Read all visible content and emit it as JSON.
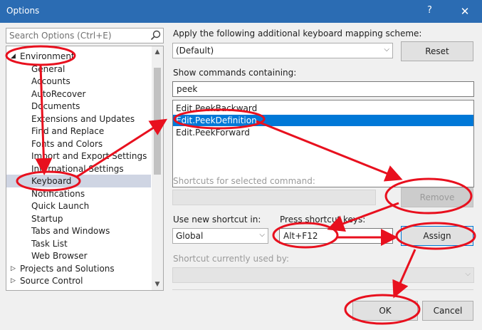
{
  "window": {
    "title": "Options",
    "help_glyph": "?",
    "close_glyph": "✕"
  },
  "search": {
    "placeholder": "Search Options (Ctrl+E)"
  },
  "tree": {
    "items": [
      {
        "label": "Environment",
        "expanded": true
      },
      {
        "label": "General"
      },
      {
        "label": "Accounts"
      },
      {
        "label": "AutoRecover"
      },
      {
        "label": "Documents"
      },
      {
        "label": "Extensions and Updates"
      },
      {
        "label": "Find and Replace"
      },
      {
        "label": "Fonts and Colors"
      },
      {
        "label": "Import and Export Settings"
      },
      {
        "label": "International Settings"
      },
      {
        "label": "Keyboard",
        "selected": true
      },
      {
        "label": "Notifications"
      },
      {
        "label": "Quick Launch"
      },
      {
        "label": "Startup"
      },
      {
        "label": "Tabs and Windows"
      },
      {
        "label": "Task List"
      },
      {
        "label": "Web Browser"
      },
      {
        "label": "Projects and Solutions",
        "collapsed": true
      },
      {
        "label": "Source Control",
        "collapsed": true
      }
    ]
  },
  "mapping": {
    "label": "Apply the following additional keyboard mapping scheme:",
    "value": "(Default)",
    "reset": "Reset"
  },
  "commands": {
    "label": "Show commands containing:",
    "filter": "peek",
    "items": [
      "Edit.PeekBackward",
      "Edit.PeekDefinition",
      "Edit.PeekForward"
    ],
    "selected_index": 1
  },
  "shortcuts_for": {
    "label": "Shortcuts for selected command:",
    "remove": "Remove"
  },
  "new_shortcut": {
    "use_in_label": "Use new shortcut in:",
    "use_in_value": "Global",
    "press_label": "Press shortcut keys:",
    "keys": "Alt+F12",
    "assign": "Assign"
  },
  "currently_used": {
    "label": "Shortcut currently used by:"
  },
  "footer": {
    "ok": "OK",
    "cancel": "Cancel"
  },
  "annotation_color": "#e8101e"
}
